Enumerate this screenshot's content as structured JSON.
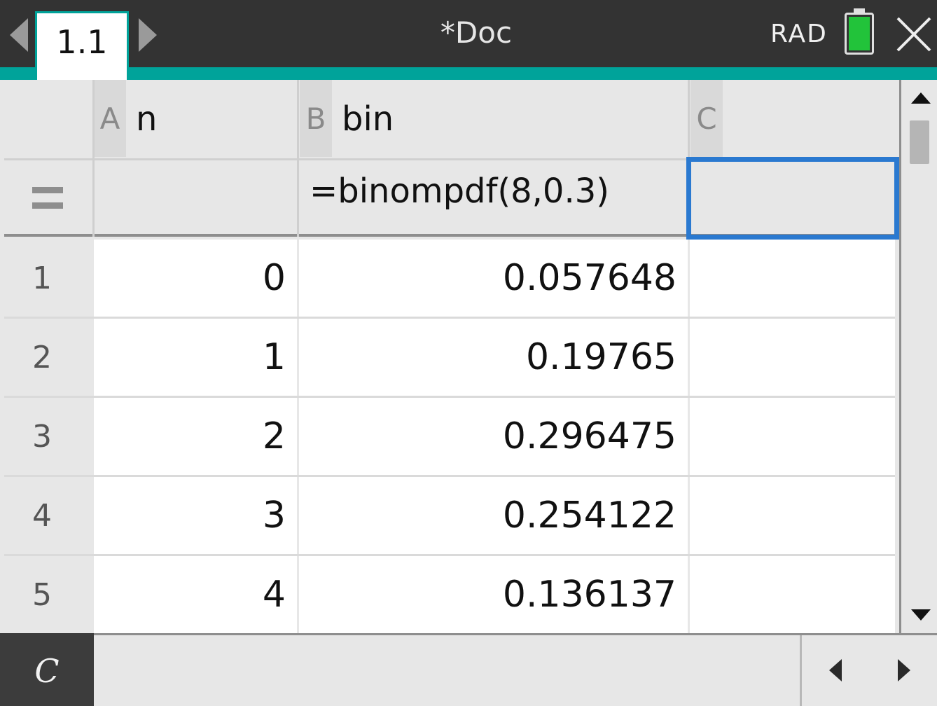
{
  "topbar": {
    "tab_label": "1.1",
    "document_title": "*Doc",
    "angle_mode": "RAD",
    "battery_color": "#22c33a",
    "accent_color": "#00a39a"
  },
  "columns": [
    {
      "letter": "A",
      "name": "n"
    },
    {
      "letter": "B",
      "name": "bin"
    },
    {
      "letter": "C",
      "name": ""
    }
  ],
  "formula_row": {
    "b": "=binompdf(8,0.3)",
    "c": ""
  },
  "rows": [
    {
      "num": "1",
      "a": "0",
      "b": "0.057648",
      "c": ""
    },
    {
      "num": "2",
      "a": "1",
      "b": "0.19765",
      "c": ""
    },
    {
      "num": "3",
      "a": "2",
      "b": "0.296475",
      "c": ""
    },
    {
      "num": "4",
      "a": "3",
      "b": "0.254122",
      "c": ""
    },
    {
      "num": "5",
      "a": "4",
      "b": "0.136137",
      "c": ""
    }
  ],
  "selection": {
    "cell": "C",
    "border_color": "#2a79d0"
  },
  "entry_line": {
    "cell_reference": "C",
    "content": ""
  }
}
